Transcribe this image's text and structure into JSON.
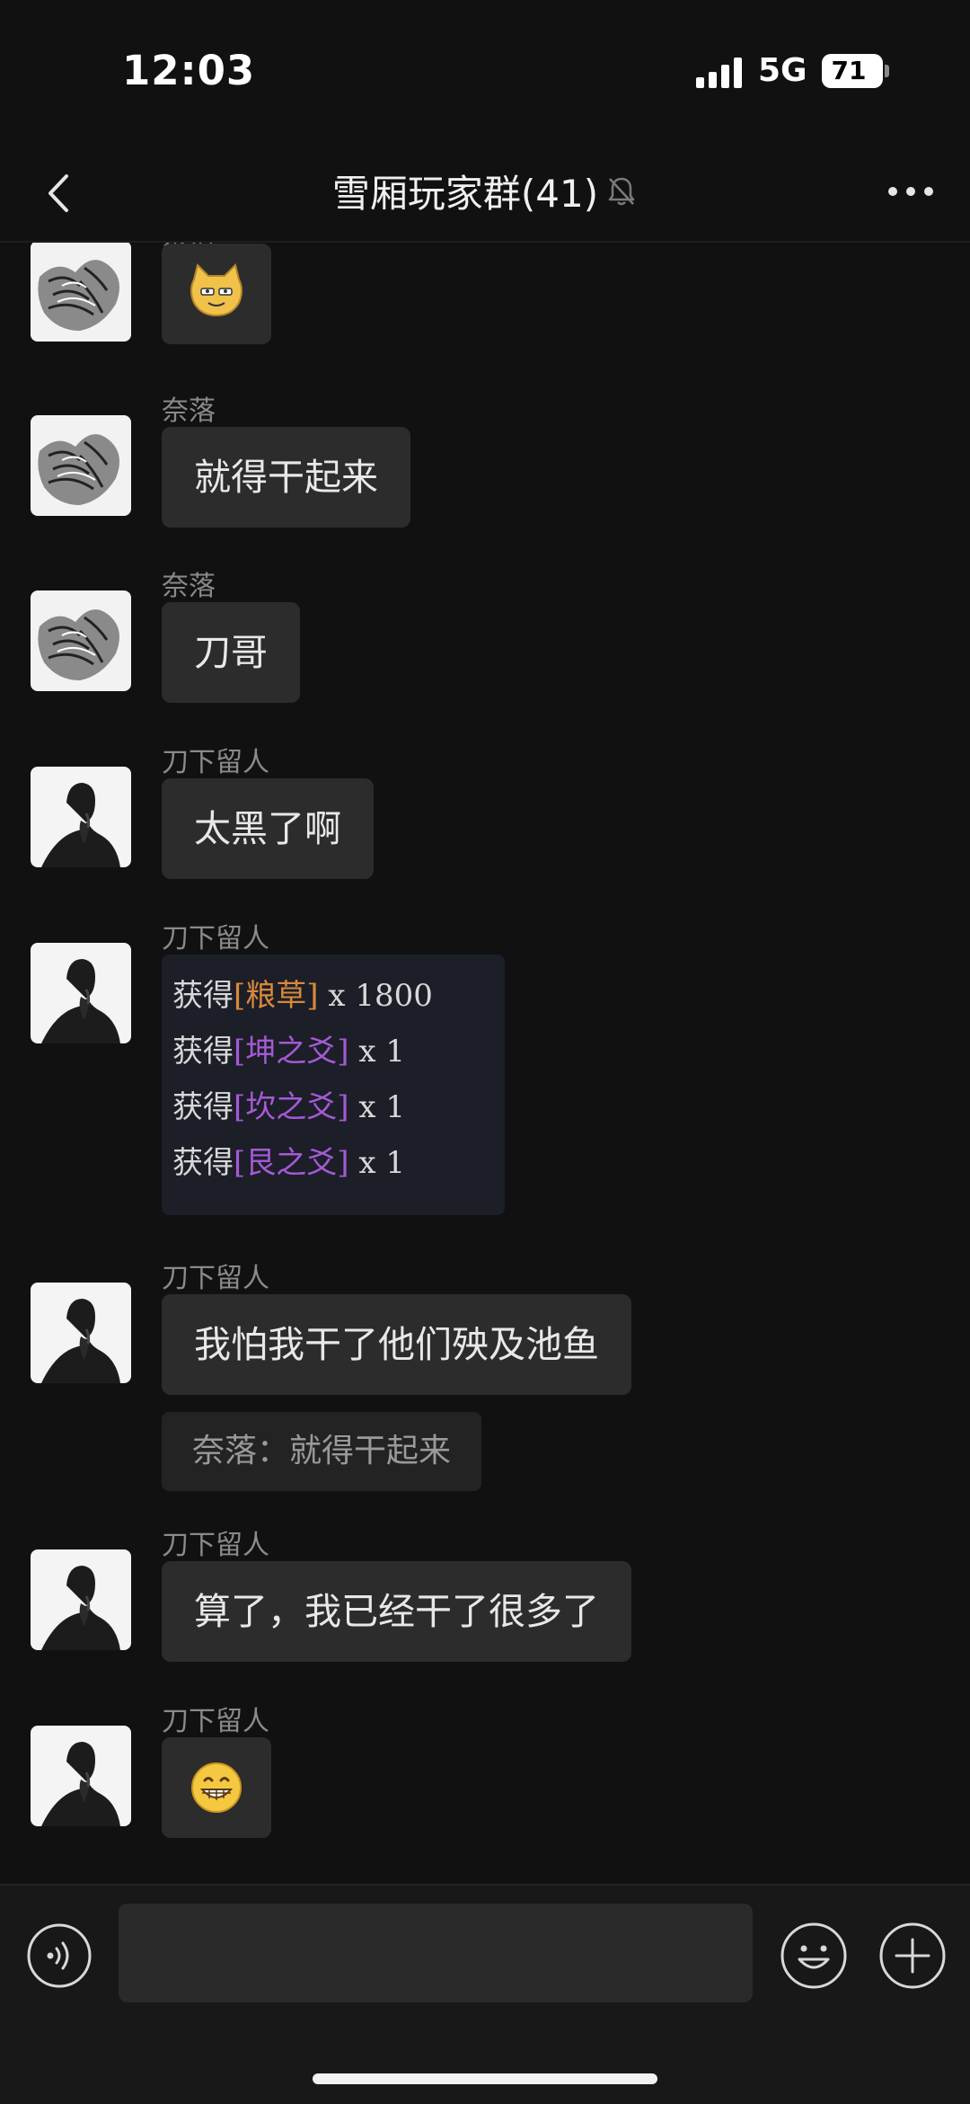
{
  "status_bar": {
    "time": "12:03",
    "network": "5G",
    "battery": "71"
  },
  "nav": {
    "title": "雪厢玩家群(41)",
    "back_icon": "chevron-left-icon",
    "mute_icon": "bell-muted-icon",
    "more_icon": "more-dots-icon"
  },
  "messages": [
    {
      "sender": "奈落",
      "type": "emoji",
      "emoji": "🐱"
    },
    {
      "sender": "奈落",
      "type": "text",
      "text": "就得干起来"
    },
    {
      "sender": "奈落",
      "type": "text",
      "text": "刀哥"
    },
    {
      "sender": "刀下留人",
      "type": "text",
      "text": "太黑了啊"
    },
    {
      "sender": "刀下留人",
      "type": "image",
      "loot": [
        {
          "prefix": "获得",
          "item": "[粮草]",
          "count": " x 1800"
        },
        {
          "prefix": "获得",
          "item": "[坤之爻]",
          "count": " x 1"
        },
        {
          "prefix": "获得",
          "item": "[坎之爻]",
          "count": " x 1"
        },
        {
          "prefix": "获得",
          "item": "[艮之爻]",
          "count": " x 1"
        }
      ]
    },
    {
      "sender": "刀下留人",
      "type": "text",
      "text": "我怕我干了他们殃及池鱼",
      "quote": "奈落：就得干起来"
    },
    {
      "sender": "刀下留人",
      "type": "text",
      "text": "算了，我已经干了很多了"
    },
    {
      "sender": "刀下留人",
      "type": "emoji",
      "emoji": "😁"
    }
  ],
  "input_bar": {
    "placeholder": "",
    "voice_icon": "voice-icon",
    "emoji_icon": "emoji-icon",
    "plus_icon": "plus-icon"
  },
  "colors": {
    "background": "#111111",
    "bubble": "#2c2c2c",
    "sender_text": "#8a8a8a",
    "loot_gold": "#d8893a",
    "loot_purple": "#a45ad4"
  }
}
